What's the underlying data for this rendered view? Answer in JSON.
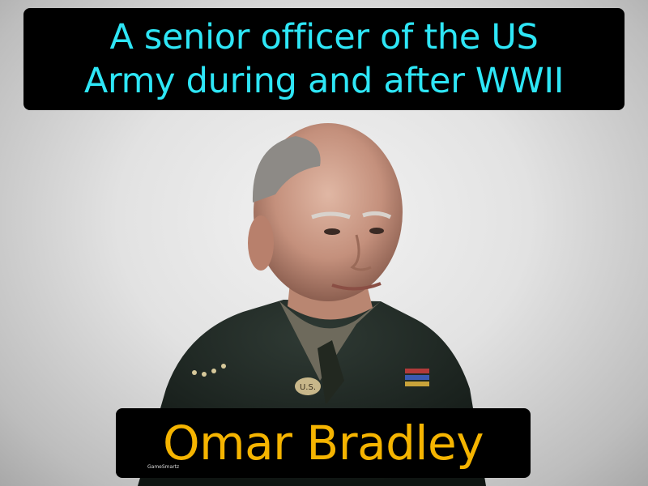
{
  "caption": {
    "line1": "A senior officer of the US",
    "line2": "Army during and after WWII"
  },
  "title": "Omar Bradley",
  "brand": "GameSmartz",
  "colors": {
    "caption_text": "#2ee6f6",
    "title_text": "#f5b400",
    "box_background": "#000000"
  }
}
